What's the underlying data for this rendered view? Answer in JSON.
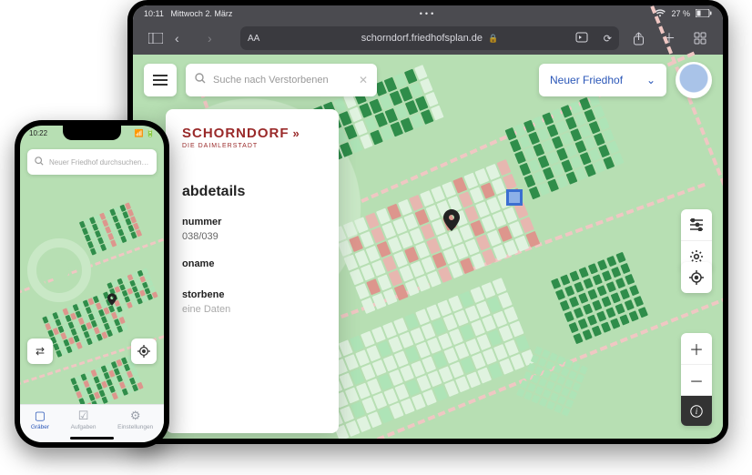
{
  "tablet": {
    "status": {
      "time": "10:11",
      "date": "Mittwoch 2. März",
      "battery": "27 %"
    },
    "browser": {
      "url": "schorndorf.friedhofsplan.de",
      "aa": "AA"
    },
    "search": {
      "placeholder": "Suche nach Verstorbenen"
    },
    "cemetery_label": "Neuer Friedhof",
    "panel": {
      "brand": "SCHORNDORF",
      "brand_sub": "DIE DAIMLERSTADT",
      "title": "abdetails",
      "num_label": "nummer",
      "num_value": "038/039",
      "name_label": "oname",
      "name_value": "",
      "dec_label": "storbene",
      "dec_value": "eine Daten"
    }
  },
  "phone": {
    "status_time": "10:22",
    "search_placeholder": "Neuer Friedhof durchsuchen…",
    "tabs": {
      "graves": "Gräber",
      "tasks": "Aufgaben",
      "settings": "Einstellungen"
    }
  }
}
